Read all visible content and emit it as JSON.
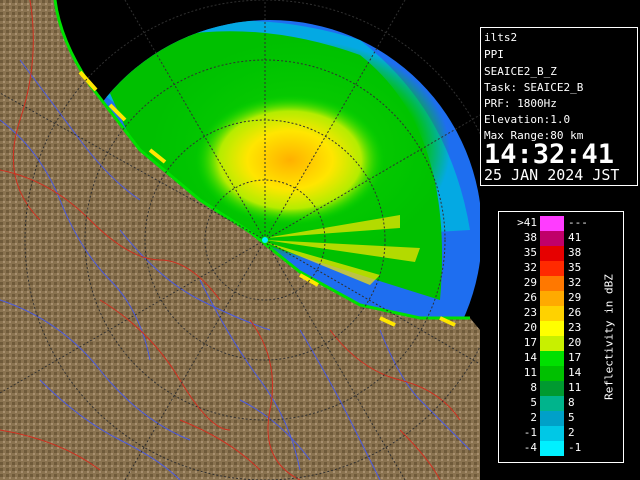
{
  "info": {
    "radar_name": "ilts2",
    "product": "PPI",
    "field": "SEAICE2_B_Z",
    "task": "Task: SEAICE2_B",
    "prf": "PRF: 1800Hz",
    "elevation": "Elevation:1.0",
    "max_range": "Max Range:80 km",
    "time": "14:32:41",
    "date": "25 JAN 2024 JST"
  },
  "legend": {
    "title": "Reflectivity in dBZ",
    "bins": [
      {
        "low": ">41",
        "high": "---",
        "color": "#ff3cff"
      },
      {
        "low": "38",
        "high": "41",
        "color": "#c0006a"
      },
      {
        "low": "35",
        "high": "38",
        "color": "#e60000"
      },
      {
        "low": "32",
        "high": "35",
        "color": "#ff2a00"
      },
      {
        "low": "29",
        "high": "32",
        "color": "#ff7800"
      },
      {
        "low": "26",
        "high": "29",
        "color": "#ffaa00"
      },
      {
        "low": "23",
        "high": "26",
        "color": "#ffd200"
      },
      {
        "low": "20",
        "high": "23",
        "color": "#ffff00"
      },
      {
        "low": "17",
        "high": "20",
        "color": "#c8f000"
      },
      {
        "low": "14",
        "high": "17",
        "color": "#00e000"
      },
      {
        "low": "11",
        "high": "14",
        "color": "#00c000"
      },
      {
        "low": "8",
        "high": "11",
        "color": "#009a30"
      },
      {
        "low": "5",
        "high": "8",
        "color": "#00b48c"
      },
      {
        "low": "2",
        "high": "5",
        "color": "#00a0c8"
      },
      {
        "low": "-1",
        "high": "2",
        "color": "#00c8e6"
      },
      {
        "low": "-4",
        "high": "-1",
        "color": "#00f0ff"
      }
    ]
  },
  "map": {
    "land_color": "#8a7350",
    "sea_color": "#1e6ef0",
    "river_color": "#4a5ae0",
    "boundary_color": "#d03020"
  }
}
